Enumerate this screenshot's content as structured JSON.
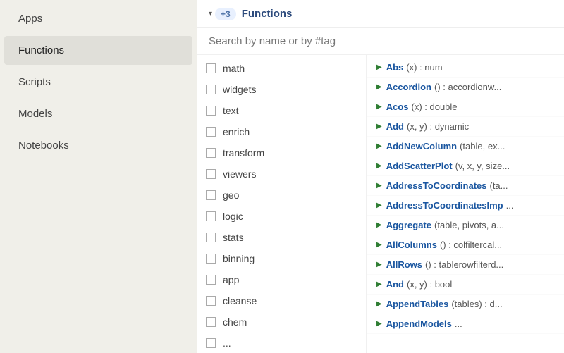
{
  "sidebar": {
    "items": [
      {
        "label": "Apps",
        "id": "apps",
        "active": false
      },
      {
        "label": "Functions",
        "id": "functions",
        "active": true
      },
      {
        "label": "Scripts",
        "id": "scripts",
        "active": false
      },
      {
        "label": "Models",
        "id": "models",
        "active": false
      },
      {
        "label": "Notebooks",
        "id": "notebooks",
        "active": false
      }
    ]
  },
  "header": {
    "badge": "+3",
    "title": "Functions"
  },
  "search": {
    "placeholder": "Search by name or by #tag"
  },
  "categories": [
    {
      "label": "math"
    },
    {
      "label": "widgets"
    },
    {
      "label": "text"
    },
    {
      "label": "enrich"
    },
    {
      "label": "transform"
    },
    {
      "label": "viewers"
    },
    {
      "label": "geo"
    },
    {
      "label": "logic"
    },
    {
      "label": "stats"
    },
    {
      "label": "binning"
    },
    {
      "label": "app"
    },
    {
      "label": "cleanse"
    },
    {
      "label": "chem"
    },
    {
      "label": "..."
    }
  ],
  "functions": [
    {
      "name": "Abs",
      "sig": "(x) : num"
    },
    {
      "name": "Accordion",
      "sig": "() : accordionw..."
    },
    {
      "name": "Acos",
      "sig": "(x) : double"
    },
    {
      "name": "Add",
      "sig": "(x, y) : dynamic"
    },
    {
      "name": "AddNewColumn",
      "sig": "(table, ex..."
    },
    {
      "name": "AddScatterPlot",
      "sig": "(v, x, y, size..."
    },
    {
      "name": "AddressToCoordinates",
      "sig": "(ta..."
    },
    {
      "name": "AddressToCoordinatesImp",
      "sig": "..."
    },
    {
      "name": "Aggregate",
      "sig": "(table, pivots, a..."
    },
    {
      "name": "AllColumns",
      "sig": "() : colfiltercal..."
    },
    {
      "name": "AllRows",
      "sig": "() : tablerowfilterd..."
    },
    {
      "name": "And",
      "sig": "(x, y) : bool"
    },
    {
      "name": "AppendTables",
      "sig": "(tables) : d..."
    },
    {
      "name": "AppendModels",
      "sig": "..."
    }
  ],
  "icons": {
    "expand": "▾",
    "play": "▶",
    "checkbox_empty": ""
  }
}
